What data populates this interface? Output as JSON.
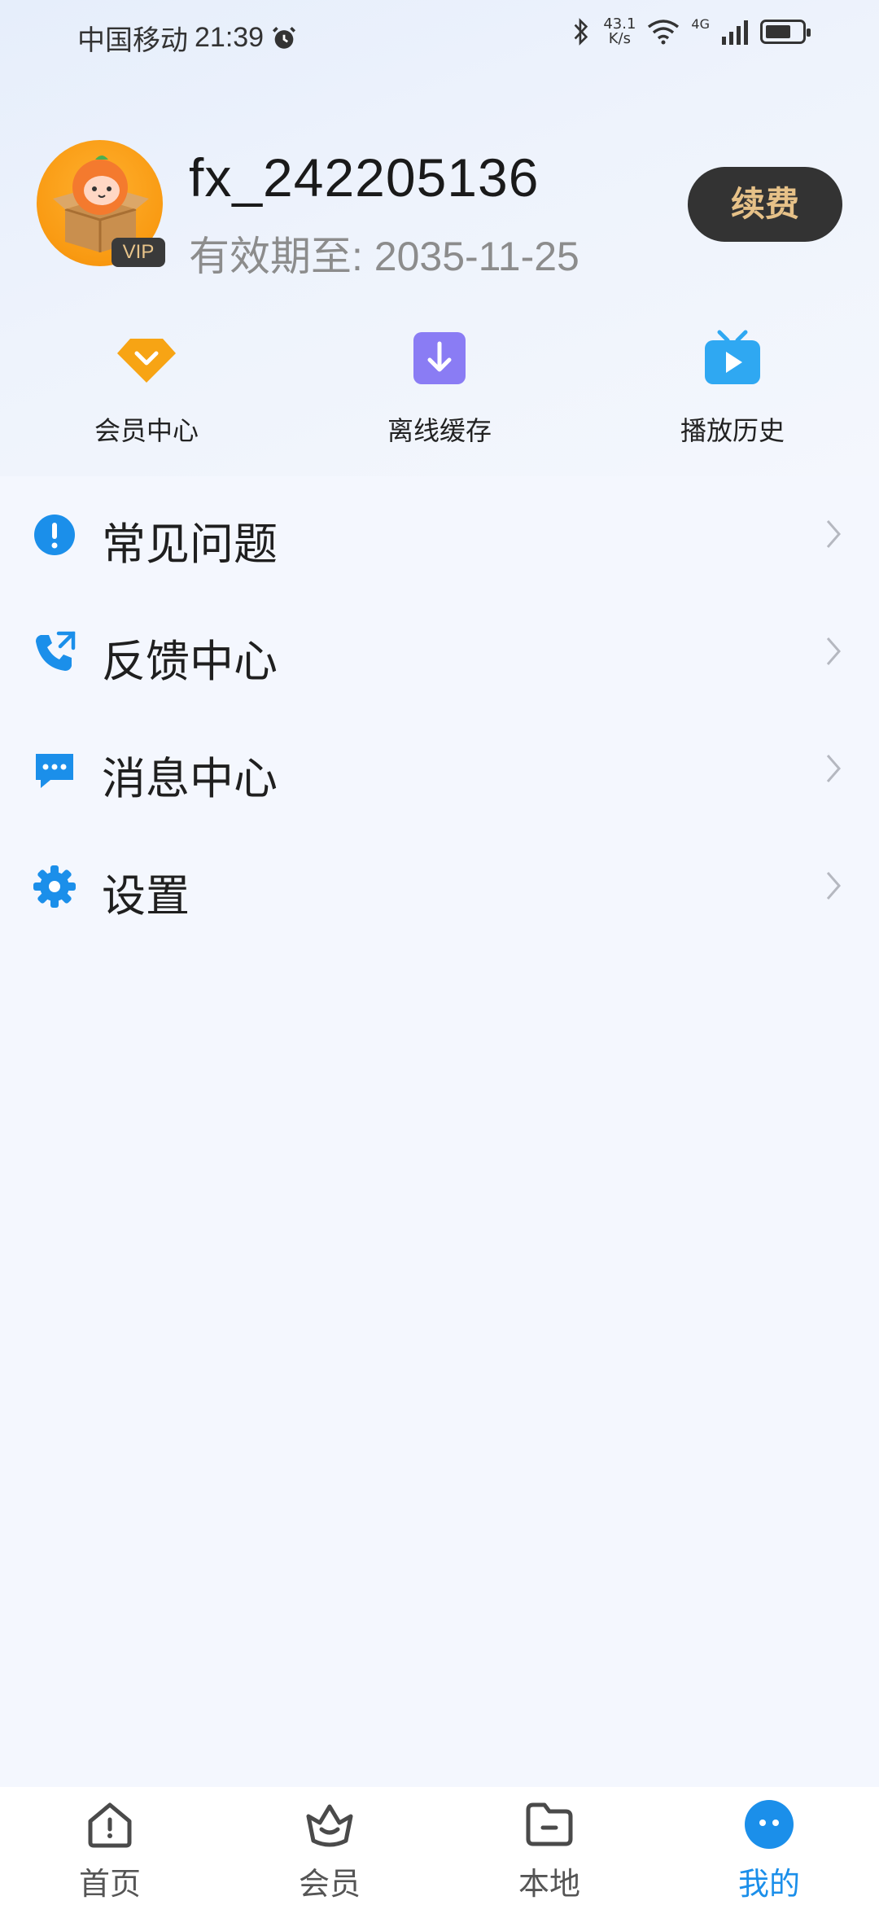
{
  "status_bar": {
    "carrier": "中国移动",
    "time": "21:39",
    "net_speed_value": "43.1",
    "net_speed_unit": "K/s",
    "network": "4G"
  },
  "profile": {
    "username": "fx_242205136",
    "expiry": "有效期至: 2035-11-25",
    "vip_badge": "VIP",
    "renew_label": "续费"
  },
  "quick_actions": [
    {
      "label": "会员中心",
      "icon": "diamond-icon",
      "color": "#f7a414"
    },
    {
      "label": "离线缓存",
      "icon": "download-icon",
      "color": "#8a7cf4"
    },
    {
      "label": "播放历史",
      "icon": "tv-play-icon",
      "color": "#2fa8f2"
    }
  ],
  "menu": [
    {
      "label": "常见问题",
      "icon": "info-icon"
    },
    {
      "label": "反馈中心",
      "icon": "phone-icon"
    },
    {
      "label": "消息中心",
      "icon": "message-icon"
    },
    {
      "label": "设置",
      "icon": "gear-icon"
    }
  ],
  "bottom_nav": [
    {
      "label": "首页",
      "icon": "home-icon"
    },
    {
      "label": "会员",
      "icon": "crown-icon"
    },
    {
      "label": "本地",
      "icon": "folder-icon"
    },
    {
      "label": "我的",
      "icon": "profile-icon",
      "active": true
    }
  ],
  "colors": {
    "accent": "#1b8fea",
    "renew_text": "#e6c188",
    "renew_bg": "#333333"
  }
}
